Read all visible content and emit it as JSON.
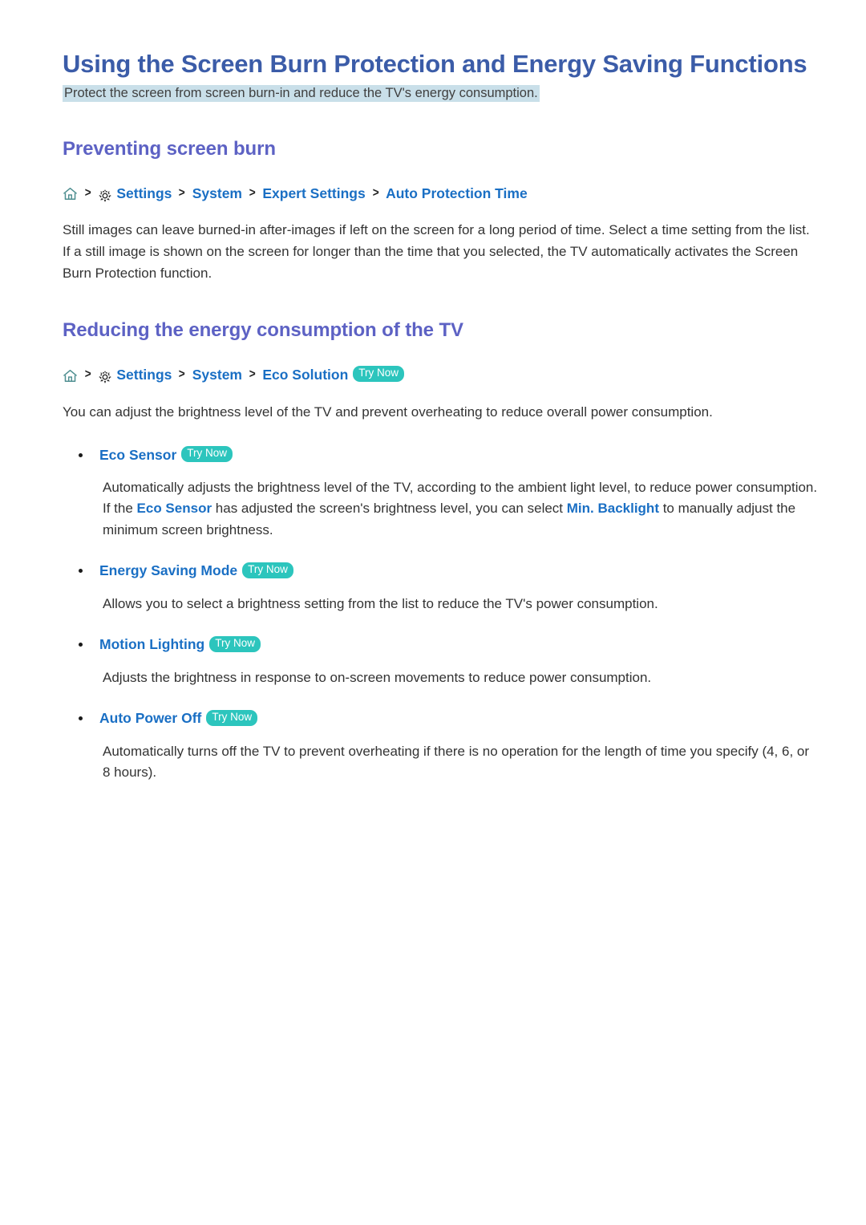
{
  "document": {
    "title": "Using the Screen Burn Protection and Energy Saving Functions",
    "subtitle": "Protect the screen from screen burn-in and reduce the TV's energy consumption."
  },
  "colors": {
    "title": "#3b5ca8",
    "heading": "#5d62c4",
    "link": "#1a6fc4",
    "badge_bg": "#2cc5bd",
    "highlight_bg": "#c9dfe9",
    "body_text": "#333333"
  },
  "sections": [
    {
      "heading": "Preventing screen burn",
      "breadcrumb": {
        "home_icon": "home-icon",
        "gear_icon": "gear-icon",
        "separator": "›",
        "crumbs": [
          "Settings",
          "System",
          "Expert Settings",
          "Auto Protection Time"
        ],
        "badge": ""
      },
      "paragraph": "Still images can leave burned-in after-images if left on the screen for a long period of time. Select a time setting from the list. If a still image is shown on the screen for longer than the time that you selected, the TV automatically activates the Screen Burn Protection function."
    },
    {
      "heading": "Reducing the energy consumption of the TV",
      "breadcrumb": {
        "home_icon": "home-icon",
        "gear_icon": "gear-icon",
        "separator": "›",
        "crumbs": [
          "Settings",
          "System",
          "Eco Solution"
        ],
        "badge": "Try Now"
      },
      "paragraph": "You can adjust the brightness level of the TV and prevent overheating to reduce overall power consumption."
    }
  ],
  "bullets": [
    {
      "label": "Eco Sensor",
      "badge": "Try Now",
      "desc_part1": "Automatically adjusts the brightness level of the TV, according to the ambient light level, to reduce power consumption. If the ",
      "desc_link1": "Eco Sensor",
      "desc_part2": " has adjusted the screen's brightness level, you can select ",
      "desc_link2": "Min. Backlight",
      "desc_part3": " to manually adjust the minimum screen brightness."
    },
    {
      "label": "Energy Saving Mode",
      "badge": "Try Now",
      "desc_part1": "Allows you to select a brightness setting from the list to reduce the TV's power consumption.",
      "desc_link1": "",
      "desc_part2": "",
      "desc_link2": "",
      "desc_part3": ""
    },
    {
      "label": "Motion Lighting",
      "badge": "Try Now",
      "desc_part1": "Adjusts the brightness in response to on-screen movements to reduce power consumption.",
      "desc_link1": "",
      "desc_part2": "",
      "desc_link2": "",
      "desc_part3": ""
    },
    {
      "label": "Auto Power Off",
      "badge": "Try Now",
      "desc_part1": "Automatically turns off the TV to prevent overheating if there is no operation for the length of time you specify (4, 6, or 8 hours).",
      "desc_link1": "",
      "desc_part2": "",
      "desc_link2": "",
      "desc_part3": ""
    }
  ]
}
